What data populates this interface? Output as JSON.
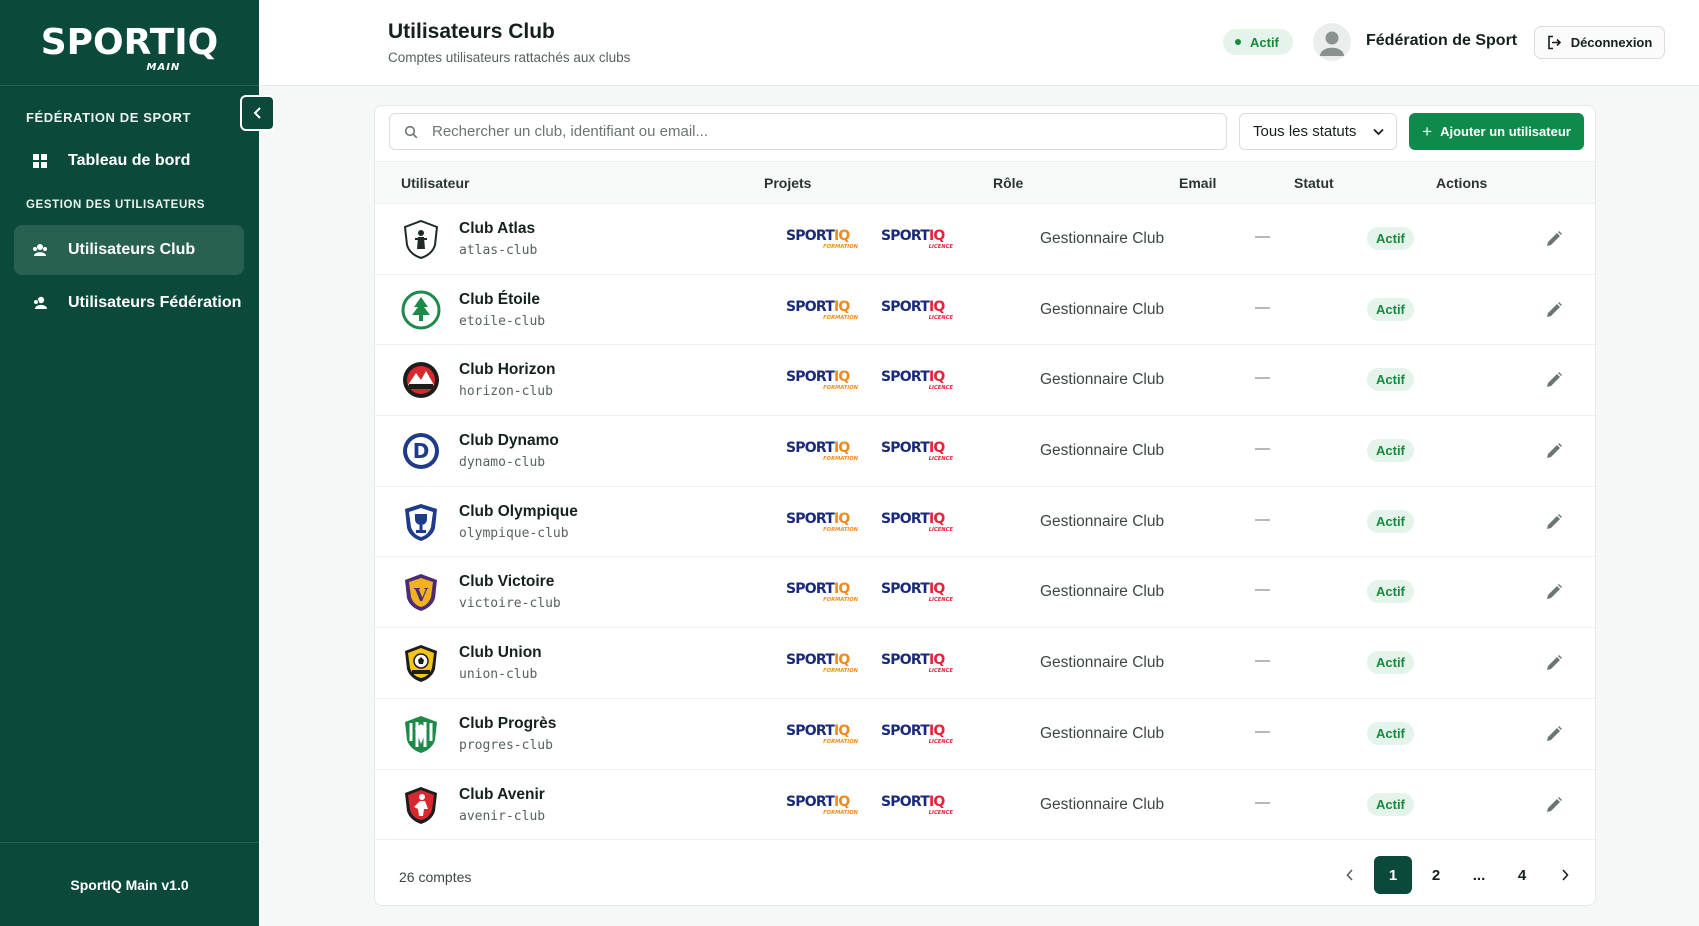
{
  "sidebar": {
    "logo_text": "SPORTIQ",
    "logo_sub": "MAIN",
    "section_federation": "FÉDÉRATION DE SPORT",
    "section_users": "GESTION DES UTILISATEURS",
    "items": [
      {
        "label": "Tableau de bord",
        "icon": "dashboard-icon"
      },
      {
        "label": "Utilisateurs Club",
        "icon": "users-icon",
        "active": true
      },
      {
        "label": "Utilisateurs Fédération",
        "icon": "user-group-icon"
      }
    ],
    "footer": "SportIQ Main v1.0",
    "colors": {
      "background": "#0b4a3b"
    }
  },
  "header": {
    "title": "Utilisateurs Club",
    "subtitle": "Comptes utilisateurs rattachés aux clubs",
    "status_badge": "Actif",
    "user_name": "Fédération de Sport",
    "logout_label": "Déconnexion"
  },
  "toolbar": {
    "search_placeholder": "Rechercher un club, identifiant ou email...",
    "status_filter": "Tous les statuts",
    "add_label": "Ajouter un utilisateur"
  },
  "table": {
    "columns": [
      "Utilisateur",
      "Projets",
      "Rôle",
      "Email",
      "Statut",
      "Actions"
    ],
    "projects": [
      {
        "brand": "SPORTIQ",
        "sub": "FORMATION"
      },
      {
        "brand": "SPORTIQ",
        "sub": "LICENCE"
      }
    ],
    "rows": [
      {
        "name": "Club Atlas",
        "id": "atlas-club",
        "role": "Gestionnaire Club",
        "email": "—",
        "status": "Actif",
        "crest": "crest-atlas-icon"
      },
      {
        "name": "Club Étoile",
        "id": "etoile-club",
        "role": "Gestionnaire Club",
        "email": "—",
        "status": "Actif",
        "crest": "crest-etoile-icon"
      },
      {
        "name": "Club Horizon",
        "id": "horizon-club",
        "role": "Gestionnaire Club",
        "email": "—",
        "status": "Actif",
        "crest": "crest-horizon-icon"
      },
      {
        "name": "Club Dynamo",
        "id": "dynamo-club",
        "role": "Gestionnaire Club",
        "email": "—",
        "status": "Actif",
        "crest": "crest-dynamo-icon"
      },
      {
        "name": "Club Olympique",
        "id": "olympique-club",
        "role": "Gestionnaire Club",
        "email": "—",
        "status": "Actif",
        "crest": "crest-olympique-icon"
      },
      {
        "name": "Club Victoire",
        "id": "victoire-club",
        "role": "Gestionnaire Club",
        "email": "—",
        "status": "Actif",
        "crest": "crest-victoire-icon"
      },
      {
        "name": "Club Union",
        "id": "union-club",
        "role": "Gestionnaire Club",
        "email": "—",
        "status": "Actif",
        "crest": "crest-union-icon"
      },
      {
        "name": "Club Progrès",
        "id": "progres-club",
        "role": "Gestionnaire Club",
        "email": "—",
        "status": "Actif",
        "crest": "crest-progres-icon"
      },
      {
        "name": "Club Avenir",
        "id": "avenir-club",
        "role": "Gestionnaire Club",
        "email": "—",
        "status": "Actif",
        "crest": "crest-avenir-icon"
      }
    ]
  },
  "pagination": {
    "count_label": "26 comptes",
    "pages": [
      "1",
      "2",
      "...",
      "4"
    ],
    "current": "1"
  },
  "colors": {
    "primary": "#0b4a3b",
    "accent": "#0e8a4a",
    "status_active_bg": "#e4f4ea",
    "status_active_text": "#168a3e",
    "brand_blue": "#1a2a7a",
    "brand_orange": "#f08a1e",
    "brand_red": "#e2233a"
  }
}
